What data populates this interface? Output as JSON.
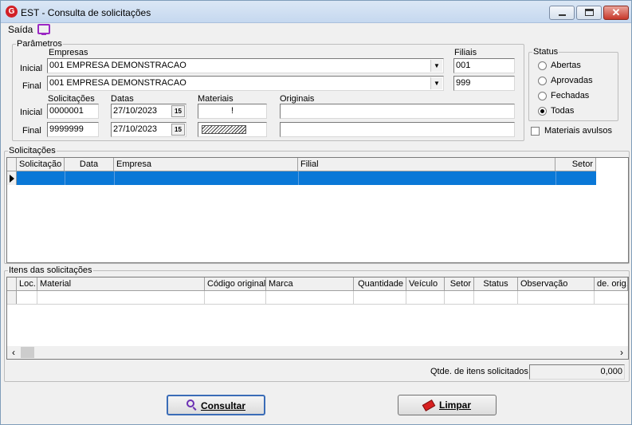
{
  "window": {
    "title": "EST - Consulta de solicitações",
    "logo_letter": "G"
  },
  "menu": {
    "saida": "Saída",
    "tv_icon": "monitor-icon"
  },
  "parametros": {
    "legend": "Parâmetros",
    "empresas_label": "Empresas",
    "filiais_label": "Filiais",
    "inicial_label": "Inicial",
    "final_label": "Final",
    "empresa_inicial": "001 EMPRESA DEMONSTRACAO",
    "empresa_final": "001 EMPRESA DEMONSTRACAO",
    "filial_inicial": "001",
    "filial_final": "999",
    "solicitacoes_label": "Solicitações",
    "datas_label": "Datas",
    "materiais_label": "Materiais",
    "originais_label": "Originais",
    "solicitacao_inicial": "0000001",
    "solicitacao_final": "9999999",
    "data_inicial": "27/10/2023",
    "data_final": "27/10/2023",
    "calendar_glyph": "15",
    "material_inicial": "!",
    "material_final": "",
    "original_inicial": "",
    "original_final": ""
  },
  "status": {
    "legend": "Status",
    "options": [
      "Abertas",
      "Aprovadas",
      "Fechadas",
      "Todas"
    ],
    "selected": "Todas"
  },
  "materiais_avulsos": "Materiais avulsos",
  "solicitacoes": {
    "legend": "Solicitações",
    "columns": [
      "Solicitação",
      "Data",
      "Empresa",
      "Filial",
      "Setor"
    ]
  },
  "itens": {
    "legend": "Itens das solicitações",
    "columns": [
      "Loc.",
      "Material",
      "Código original",
      "Marca",
      "Quantidade",
      "Veículo",
      "Setor",
      "Status",
      "Observação",
      "de. orig."
    ]
  },
  "qtde": {
    "label": "Qtde. de itens solicitados",
    "value": "0,000"
  },
  "buttons": {
    "consultar": "Consultar",
    "limpar": "Limpar"
  }
}
